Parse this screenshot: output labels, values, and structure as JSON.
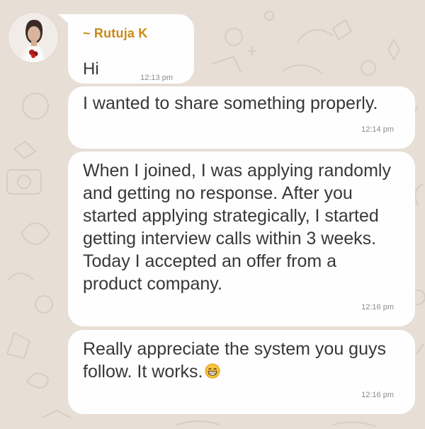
{
  "chat": {
    "sender_name": "~ Rutuja K",
    "messages": [
      {
        "text": "Hi",
        "time": "12:13 pm"
      },
      {
        "text": "I wanted to share something properly.",
        "time": "12:14 pm"
      },
      {
        "text": "When I joined, I was applying randomly\nand getting no response. After you\nstarted applying strategically, I started\ngetting interview calls within 3 weeks.\nToday I accepted an offer from a\nproduct company.",
        "time": "12:16 pm"
      },
      {
        "text": "Really appreciate the system you guys\nfollow. It works.",
        "time": "12:16 pm"
      }
    ]
  },
  "icons": {
    "avatar": "profile-photo",
    "emoji": "grinning-face-emoji"
  },
  "colors": {
    "background": "#e7ded5",
    "bubble": "#fefefe",
    "sender_name": "#c98a17",
    "timestamp": "#8c8c8c"
  }
}
